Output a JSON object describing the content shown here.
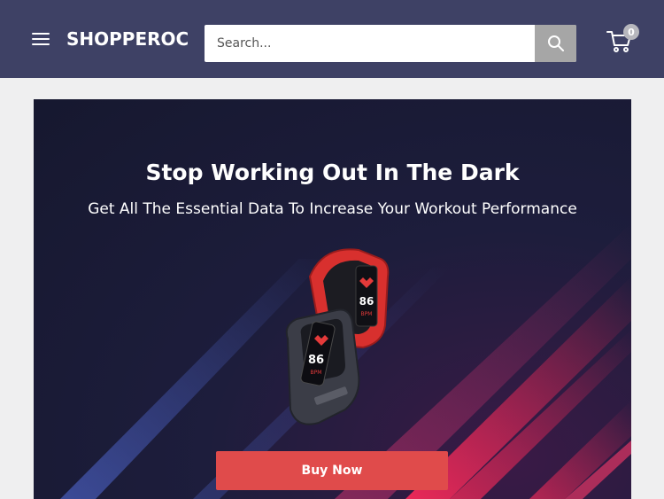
{
  "header": {
    "logo": "SHOPPEROC",
    "search": {
      "placeholder": "Search..."
    },
    "cart": {
      "count": "0"
    }
  },
  "hero": {
    "title": "Stop Working Out In The Dark",
    "subtitle": "Get All The Essential Data To Increase Your Workout Performance",
    "watch_display_value": "86",
    "watch_display_unit": "BPM",
    "cta_label": "Buy Now"
  },
  "colors": {
    "header_bg": "#3e4165",
    "page_bg": "#efeff0",
    "hero_bg": "#16182f",
    "cta": "#e04b4b",
    "search_button": "#a6a6a6"
  },
  "icons": [
    "menu-icon",
    "search-icon",
    "cart-icon"
  ]
}
